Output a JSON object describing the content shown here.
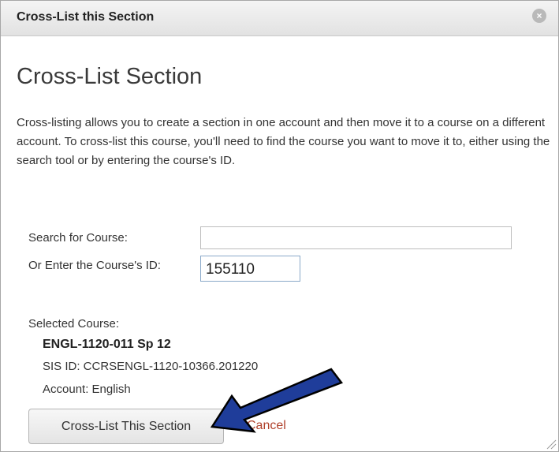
{
  "dialog": {
    "title": "Cross-List this Section",
    "close_icon": "close-icon",
    "heading": "Cross-List Section",
    "description": "Cross-listing allows you to create a section in one account and then move it to a course on a different account. To cross-list this course, you'll need to find the course you want to move it to, either using the search tool or by entering the course's ID.",
    "search": {
      "label": "Search for Course:",
      "value": "",
      "placeholder": ""
    },
    "course_id": {
      "label": "Or Enter the Course's ID:",
      "value": "155110"
    },
    "selected_course": {
      "label": "Selected Course:",
      "name": "ENGL-1120-011 Sp 12",
      "sis_id": "SIS ID: CCRSENGL-1120-10366.201220",
      "account": "Account: English"
    },
    "buttons": {
      "submit": "Cross-List This Section",
      "cancel": "Cancel"
    }
  },
  "colors": {
    "annotation_arrow": "#1f3d9a",
    "cancel_link": "#b0412c",
    "title_bar": "#e8e8e8"
  }
}
